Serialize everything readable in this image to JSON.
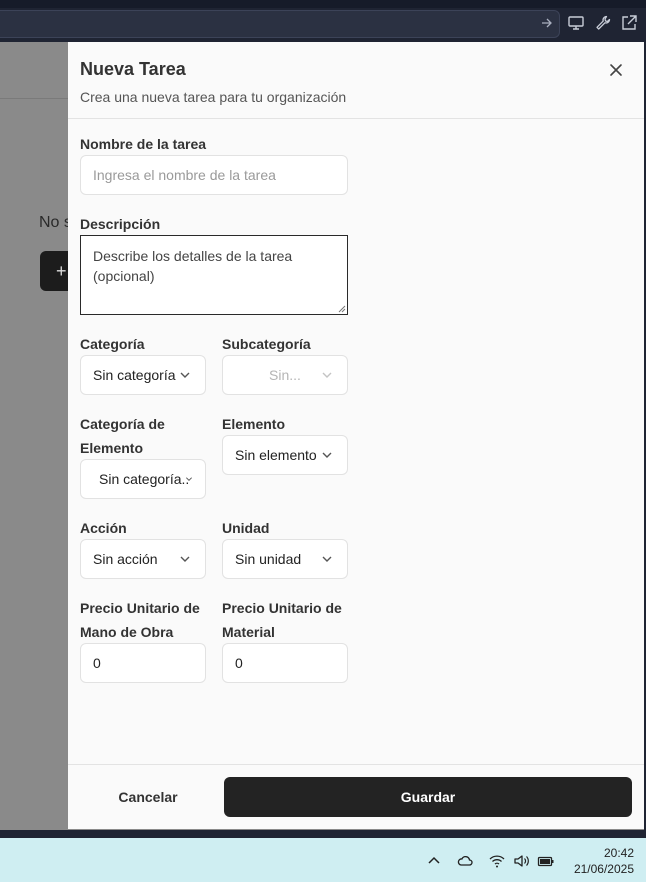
{
  "browser": {
    "icons": [
      "arrow-right-icon",
      "monitor-icon",
      "wrench-icon",
      "external-link-icon"
    ]
  },
  "background_app": {
    "empty_text": "No s",
    "button_glyph": "+"
  },
  "dialog": {
    "title": "Nueva Tarea",
    "subtitle": "Crea una nueva tarea para tu organización",
    "fields": {
      "name": {
        "label": "Nombre de la tarea",
        "placeholder": "Ingresa el nombre de la tarea",
        "value": ""
      },
      "description": {
        "label": "Descripción",
        "placeholder": "Describe los detalles de la tarea (opcional)",
        "value": ""
      },
      "category": {
        "label": "Categoría",
        "value": "Sin categoría"
      },
      "subcategory": {
        "label": "Subcategoría",
        "value": "Sin..."
      },
      "element_category": {
        "label_line1": "Categoría de",
        "label_line2": "Elemento",
        "value": "Sin categoría.."
      },
      "element": {
        "label": "Elemento",
        "value": "Sin elemento"
      },
      "action": {
        "label": "Acción",
        "value": "Sin acción"
      },
      "unit": {
        "label": "Unidad",
        "value": "Sin unidad"
      },
      "labor_price": {
        "label_line1": "Precio Unitario de",
        "label_line2": "Mano de Obra",
        "value": "0"
      },
      "material_price": {
        "label_line1": "Precio Unitario de",
        "label_line2": "Material",
        "value": "0"
      }
    },
    "cancel_label": "Cancelar",
    "save_label": "Guardar",
    "colors": {
      "primary_button": "#232323",
      "sheet_bg": "#fafafa"
    }
  },
  "taskbar": {
    "time": "20:42",
    "date": "21/06/2025",
    "tray_icons": [
      "chevron-up-icon",
      "cloud-icon",
      "wifi-icon",
      "speaker-icon",
      "battery-icon"
    ]
  }
}
